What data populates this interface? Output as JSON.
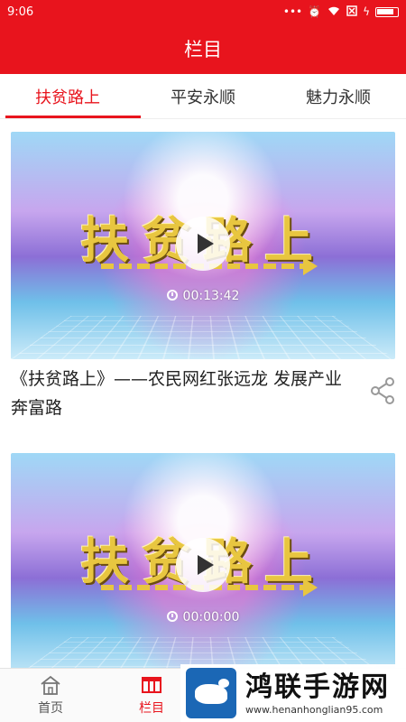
{
  "status_bar": {
    "time": "9:06",
    "icons": [
      "more-dots",
      "alarm-icon",
      "wifi-icon",
      "sim-off-icon",
      "charging-icon",
      "battery-icon"
    ]
  },
  "header": {
    "title": "栏目"
  },
  "tabs": [
    {
      "label": "扶贫路上",
      "active": true
    },
    {
      "label": "平安永顺",
      "active": false
    },
    {
      "label": "魅力永顺",
      "active": false
    }
  ],
  "feed": {
    "items": [
      {
        "art_title": "扶贫路上",
        "duration": "00:13:42",
        "title": "《扶贫路上》——农民网红张远龙 发展产业奔富路"
      },
      {
        "art_title": "扶贫路上",
        "duration": "00:00:00",
        "title": ""
      }
    ]
  },
  "bottom_nav": [
    {
      "label": "首页",
      "active": false
    },
    {
      "label": "栏目",
      "active": true
    }
  ],
  "watermark": {
    "title": "鸿联手游网",
    "url": "www.henanhonglian95.com"
  },
  "colors": {
    "brand_red": "#e8141d",
    "tab_active": "#e8141d"
  }
}
